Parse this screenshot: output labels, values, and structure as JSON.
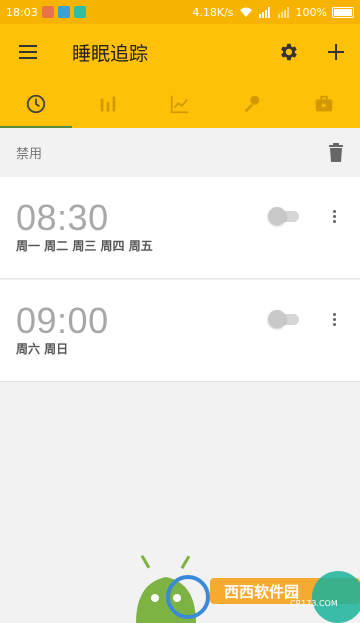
{
  "status_bar": {
    "time": "18:03",
    "network_speed": "4.18K/s",
    "battery_percent": "100%",
    "icons": [
      "notification-app-icon",
      "notification-app-icon",
      "notification-app-icon",
      "wifi-icon",
      "signal-icon",
      "signal-icon",
      "battery-icon"
    ]
  },
  "app_bar": {
    "title": "睡眠追踪",
    "menu_icon": "hamburger-menu-icon",
    "actions": [
      "gear-icon",
      "plus-icon"
    ]
  },
  "tabs": [
    {
      "icon": "alarm-clock-icon",
      "active": true
    },
    {
      "icon": "bar-chart-icon",
      "active": false
    },
    {
      "icon": "line-chart-icon",
      "active": false
    },
    {
      "icon": "microphone-icon",
      "active": false
    },
    {
      "icon": "briefcase-icon",
      "active": false
    }
  ],
  "section": {
    "label": "禁用",
    "action_icon": "trash-icon"
  },
  "alarms": [
    {
      "time": "08:30",
      "days": "周一 周二 周三 周四 周五",
      "enabled": false
    },
    {
      "time": "09:00",
      "days": "周六 周日",
      "enabled": false
    }
  ],
  "watermark": {
    "text": "西西软件园",
    "url_text": "CR173.COM",
    "icon": "android-robot-icon"
  },
  "colors": {
    "app_bar": "#ffc107",
    "status_bar": "#f6b400",
    "tab_indicator": "#5a8a3a",
    "background": "#f2f2f2"
  }
}
